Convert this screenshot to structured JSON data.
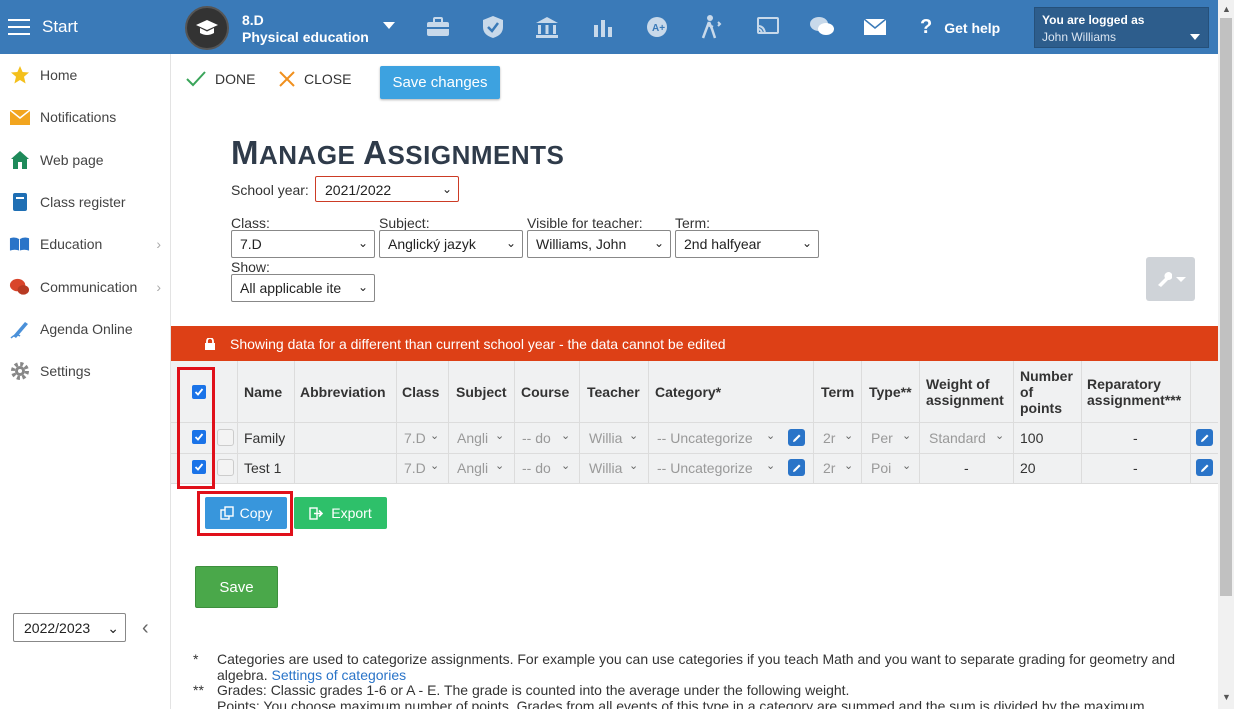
{
  "topbar": {
    "start_label": "Start",
    "class_code": "8.D",
    "class_subject": "Physical education",
    "help_label": "Get help",
    "logged_label": "You are logged as",
    "user_name": "John Williams"
  },
  "sidebar": {
    "items": [
      {
        "label": "Home",
        "icon": "star-icon"
      },
      {
        "label": "Notifications",
        "icon": "envelope-icon"
      },
      {
        "label": "Web page",
        "icon": "house-icon"
      },
      {
        "label": "Class register",
        "icon": "book-icon"
      },
      {
        "label": "Education",
        "icon": "open-book-icon"
      },
      {
        "label": "Communication",
        "icon": "chat-icon"
      },
      {
        "label": "Agenda Online",
        "icon": "pen-icon"
      },
      {
        "label": "Settings",
        "icon": "gear-icon"
      }
    ],
    "year": "2022/2023"
  },
  "toolbar": {
    "done_label": "DONE",
    "close_label": "CLOSE",
    "save_changes_label": "Save changes"
  },
  "page": {
    "title_big_m": "M",
    "title_rest_1": "ANAGE ",
    "title_big_a": "A",
    "title_rest_2": "SSIGNMENTS",
    "school_year_label": "School year:",
    "school_year_value": "2021/2022",
    "class_label": "Class:",
    "class_value": "7.D",
    "subject_label": "Subject:",
    "subject_value": "Anglický jazyk",
    "teacher_label": "Visible for teacher:",
    "teacher_value": "Williams, John",
    "term_label": "Term:",
    "term_value": "2nd halfyear",
    "show_label": "Show:",
    "show_value": "All applicable ite"
  },
  "banner": {
    "text": "Showing data for a different than current school year - the data cannot be edited"
  },
  "table": {
    "headers": {
      "name": "Name",
      "abbreviation": "Abbreviation",
      "class": "Class",
      "subject": "Subject",
      "course": "Course",
      "teacher": "Teacher",
      "category": "Category*",
      "term": "Term",
      "type": "Type**",
      "weight_1": "Weight of",
      "weight_2": "assignment",
      "points_1": "Number",
      "points_2": "of",
      "points_3": "points",
      "reparatory_1": "Reparatory",
      "reparatory_2": "assignment***"
    },
    "rows": [
      {
        "name": "Family",
        "class": "7.D",
        "subject": "Angli",
        "course": "-- do",
        "teacher": "Willia",
        "category": "-- Uncategorize",
        "term": "2r",
        "type": "Per",
        "weight": "Standard",
        "points": "100",
        "reparatory": "-"
      },
      {
        "name": "Test 1",
        "class": "7.D",
        "subject": "Angli",
        "course": "-- do",
        "teacher": "Willia",
        "category": "-- Uncategorize",
        "term": "2r",
        "type": "Poi",
        "weight": "-",
        "points": "20",
        "reparatory": "-"
      }
    ]
  },
  "actions": {
    "copy_label": "Copy",
    "export_label": "Export",
    "save_label": "Save"
  },
  "footnotes": {
    "n1_mark": "*",
    "n1_text": "Categories are used to categorize assignments. For example you can use categories if you teach Math and you want to separate grading for geometry and",
    "n1_text2": "algebra.",
    "n1_link": "Settings of categories",
    "n2_mark": "**",
    "n2_text": "Grades: Classic grades 1-6 or A - E. The grade is counted into the average under the following weight.",
    "n3_text": "Points: You choose maximum number of points. Grades from all events of this type in a category are summed and the sum is divided by the maximum"
  },
  "colors": {
    "topbar": "#3a7ab8",
    "banner": "#dd4016",
    "copy": "#3896dc",
    "export": "#2ec06a",
    "save": "#4aa84a",
    "highlight": "#e0101a"
  }
}
